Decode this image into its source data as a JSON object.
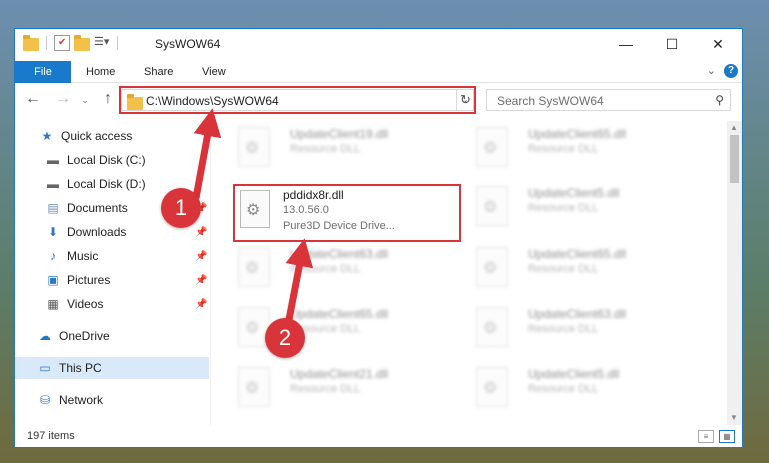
{
  "window": {
    "title": "SysWOW64",
    "controls": {
      "minimize": "—",
      "maximize": "☐",
      "close": "✕"
    }
  },
  "ribbon": {
    "tabs": [
      "File",
      "Home",
      "Share",
      "View"
    ],
    "help": "?"
  },
  "address": {
    "path": "C:\\Windows\\SysWOW64",
    "search_placeholder": "Search SysWOW64"
  },
  "nav": {
    "items": [
      {
        "label": "Quick access",
        "icon": "star-icon",
        "pinned": false
      },
      {
        "label": "Local Disk (C:)",
        "icon": "drive-icon",
        "pinned": false
      },
      {
        "label": "Local Disk (D:)",
        "icon": "drive-icon",
        "pinned": false
      },
      {
        "label": "Documents",
        "icon": "documents-icon",
        "pinned": true
      },
      {
        "label": "Downloads",
        "icon": "download-icon",
        "pinned": true
      },
      {
        "label": "Music",
        "icon": "music-icon",
        "pinned": true
      },
      {
        "label": "Pictures",
        "icon": "pictures-icon",
        "pinned": true
      },
      {
        "label": "Videos",
        "icon": "videos-icon",
        "pinned": true
      },
      {
        "label": "OneDrive",
        "icon": "cloud-icon",
        "pinned": false
      },
      {
        "label": "This PC",
        "icon": "computer-icon",
        "pinned": false,
        "selected": true
      },
      {
        "label": "Network",
        "icon": "network-icon",
        "pinned": false
      }
    ]
  },
  "files": {
    "blurred": [
      {
        "name": "UpdateClient19.dll",
        "desc": "Resource DLL"
      },
      {
        "name": "UpdateClient65.dll",
        "desc": "Resource DLL"
      },
      {
        "name": "UpdateClient5.dll",
        "desc": "Resource DLL"
      },
      {
        "name": "UpdateClient63.dll",
        "desc": "Resource DLL"
      },
      {
        "name": "UpdateClient65.dll",
        "desc": "Resource DLL"
      },
      {
        "name": "UpdateClient65.dll",
        "desc": "Resource DLL"
      },
      {
        "name": "UpdateClient63.dll",
        "desc": "Resource DLL"
      },
      {
        "name": "UpdateClient21.dll",
        "desc": "Resource DLL"
      },
      {
        "name": "UpdateClient5.dll",
        "desc": "Resource DLL"
      }
    ],
    "focus": {
      "name": "pddidx8r.dll",
      "version": "13.0.56.0",
      "desc": "Pure3D Device Drive..."
    }
  },
  "status": {
    "items_count": "197 items"
  },
  "callouts": {
    "step1": "1",
    "step2": "2"
  },
  "colors": {
    "accent": "#1979ca",
    "highlight": "#d9343a"
  }
}
